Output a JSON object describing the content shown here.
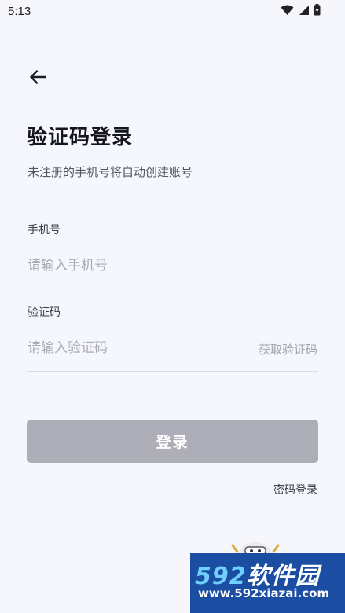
{
  "status_bar": {
    "time": "5:13",
    "icons": [
      "wifi-icon",
      "signal-icon",
      "battery-charging-icon"
    ]
  },
  "header": {
    "back_icon": "arrow-left-icon",
    "title": "验证码登录",
    "subtitle": "未注册的手机号将自动创建账号"
  },
  "form": {
    "phone_label": "手机号",
    "phone_placeholder": "请输入手机号",
    "phone_value": "",
    "code_label": "验证码",
    "code_placeholder": "请输入验证码",
    "code_value": "",
    "get_code_label": "获取验证码"
  },
  "actions": {
    "login_label": "登录",
    "password_login_label": "密码登录"
  },
  "watermark": {
    "brand_num": "592",
    "brand_text": "软件园",
    "url": "www.592xiazai.com"
  },
  "colors": {
    "background": "#f6f7fc",
    "button_disabled": "#adaeb7",
    "watermark_bg": "#1b4ea2"
  }
}
